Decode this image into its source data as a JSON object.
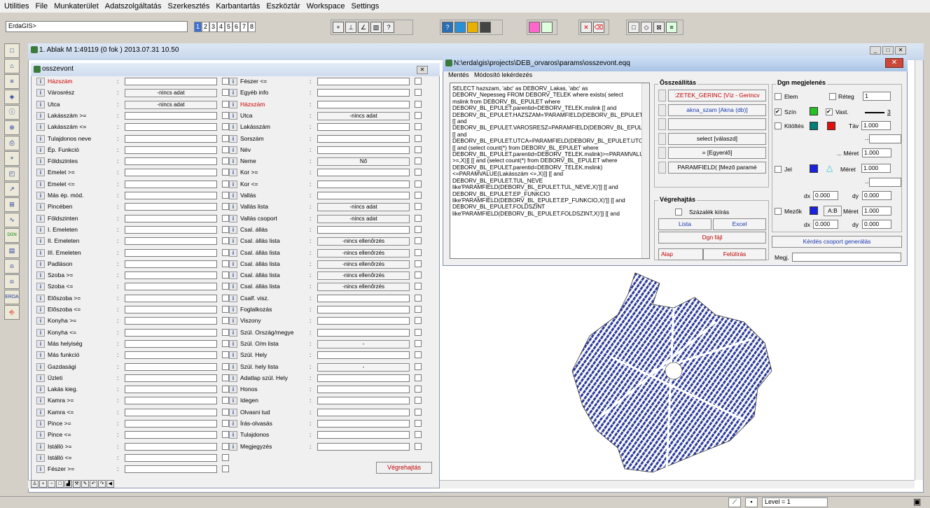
{
  "menubar": [
    "Utilities",
    "File",
    "Munkaterület",
    "Adatszolgáltatás",
    "Szerkesztés",
    "Karbantartás",
    "Eszköztár",
    "Workspace",
    "Settings"
  ],
  "command_value": "ErdaGIS>",
  "view_numbers": [
    "1",
    "2",
    "3",
    "4",
    "5",
    "6",
    "7",
    "8"
  ],
  "window1": {
    "title": "1. Ablak  M 1:49119  (0 fok ) 2013.07.31 10.50"
  },
  "statusbar": {
    "level": "Level = 1"
  },
  "osszevont": {
    "title": "osszevont",
    "info_glyph": "i",
    "colon": ":",
    "left_rows": [
      {
        "label": "Házszám",
        "red": true,
        "type": "field"
      },
      {
        "label": "Városrész",
        "type": "button",
        "value": "-nincs adat"
      },
      {
        "label": "Utca",
        "type": "button",
        "value": "-nincs adat"
      },
      {
        "label": "Lakásszám >=",
        "type": "field"
      },
      {
        "label": "Lakásszám <=",
        "type": "field"
      },
      {
        "label": "Tulajdonos neve",
        "type": "field"
      },
      {
        "label": "Ép. Funkció",
        "type": "field"
      },
      {
        "label": "Földszintes",
        "type": "field"
      },
      {
        "label": "Emelet >=",
        "type": "field"
      },
      {
        "label": "Emelet <=",
        "type": "field"
      },
      {
        "label": "Más ép. mód.",
        "type": "field"
      },
      {
        "label": "Pincében",
        "type": "field"
      },
      {
        "label": "Földszinten",
        "type": "field"
      },
      {
        "label": "I. Emeleten",
        "type": "field"
      },
      {
        "label": "II. Emeleten",
        "type": "field"
      },
      {
        "label": "III. Emeleten",
        "type": "field"
      },
      {
        "label": "Padláson",
        "type": "field"
      },
      {
        "label": "Szoba >=",
        "type": "field"
      },
      {
        "label": "Szoba <=",
        "type": "field"
      },
      {
        "label": "Előszoba >=",
        "type": "field"
      },
      {
        "label": "Előszoba <=",
        "type": "field"
      },
      {
        "label": "Konyha >=",
        "type": "field"
      },
      {
        "label": "Konyha <=",
        "type": "field"
      },
      {
        "label": "Más helyiség",
        "type": "field"
      },
      {
        "label": "Más funkció",
        "type": "field"
      },
      {
        "label": "Gazdasági",
        "type": "field"
      },
      {
        "label": "Üzleti",
        "type": "field"
      },
      {
        "label": "Lakás kieg.",
        "type": "field"
      },
      {
        "label": "Kamra >=",
        "type": "field"
      },
      {
        "label": "Kamra <=",
        "type": "field"
      },
      {
        "label": "Pince >=",
        "type": "field"
      },
      {
        "label": "Pince <=",
        "type": "field"
      },
      {
        "label": "Istálló >=",
        "type": "field"
      },
      {
        "label": "Istálló <=",
        "type": "field"
      },
      {
        "label": "Fészer >=",
        "type": "field"
      }
    ],
    "right_rows": [
      {
        "label": "Fészer <=",
        "type": "field"
      },
      {
        "label": "Egyéb info",
        "type": "field"
      },
      {
        "label": "Házszám",
        "red": true,
        "type": "field"
      },
      {
        "label": "Utca",
        "type": "button",
        "value": "-nincs adat"
      },
      {
        "label": "Lakásszám",
        "type": "field"
      },
      {
        "label": "Sorszám",
        "type": "field"
      },
      {
        "label": "Név",
        "type": "field"
      },
      {
        "label": "Neme",
        "type": "button",
        "value": "Nő"
      },
      {
        "label": "Kor >=",
        "type": "field"
      },
      {
        "label": "Kor <=",
        "type": "field"
      },
      {
        "label": "Vallás",
        "type": "field"
      },
      {
        "label": "Vallás lista",
        "type": "button",
        "value": "-nincs adat"
      },
      {
        "label": "Vallás csoport",
        "type": "button",
        "value": "-nincs adat"
      },
      {
        "label": "Csal. állás",
        "type": "field"
      },
      {
        "label": "Csal. állás lista",
        "type": "button",
        "value": "-nincs ellenőrzés"
      },
      {
        "label": "Csal. állás lista",
        "type": "button",
        "value": "-nincs ellenőrzés"
      },
      {
        "label": "Csal. állás lista",
        "type": "button",
        "value": "-nincs ellenőrzés"
      },
      {
        "label": "Csal. állás lista",
        "type": "button",
        "value": "-nincs ellenőrzés"
      },
      {
        "label": "Csal. állás lista",
        "type": "button",
        "value": "-nincs ellenőrzés"
      },
      {
        "label": "Csalf. visz.",
        "type": "field"
      },
      {
        "label": "Foglalkozás",
        "type": "field"
      },
      {
        "label": "Viszony",
        "type": "field"
      },
      {
        "label": "Szül. Ország/megye",
        "type": "field"
      },
      {
        "label": "Szül. O/m lista",
        "type": "button",
        "value": "-"
      },
      {
        "label": "Szül. Hely",
        "type": "field"
      },
      {
        "label": "Szül. hely lista",
        "type": "button",
        "value": "-"
      },
      {
        "label": "Adatlap szül. Hely",
        "type": "field"
      },
      {
        "label": "Honos",
        "type": "field"
      },
      {
        "label": "Idegen",
        "type": "field"
      },
      {
        "label": "Olvasni tud",
        "type": "field"
      },
      {
        "label": "Írás-olvasás",
        "type": "field"
      },
      {
        "label": "Tulajdonos",
        "type": "field"
      },
      {
        "label": "Megjegyzés",
        "type": "field"
      }
    ],
    "execute_label": "Végrehajtás"
  },
  "eqq": {
    "title": "N:\\erda\\gis\\projects\\DEB_orvaros\\params\\osszevont.eqq",
    "menu": [
      "Mentés",
      "Módosító lekérdezés"
    ],
    "sql": "SELECT hazszam, 'abc' as DEBORV_Lakas, 'abc' as DEBORV_Nepesseg FROM DEBORV_TELEK where exists( select mslink from DEBORV_BL_EPULET where DEBORV_BL_EPULET.parentid=DEBORV_TELEK.mslink [[ and DEBORV_BL_EPULET.HAZSZAM='PARAMFIELD(DEBORV_BL_EPULET.HAZSZAM,X)']] [[ and DEBORV_BL_EPULET.VAROSRESZ=PARAMFIELD(DEBORV_BL_EPULET.VAROSRESZ,X)]] [[ and DEBORV_BL_EPULET.UTCA=PARAMFIELD(DEBORV_BL_EPULET.UTCA,X)]] [[ and (select count(*) from DEBORV_BL_EPULET where DEBORV_BL_EPULET.parentid=DEBORV_TELEK.mslink)>=PARAMVALUE(Lakásszám >=,X)]] [[ and (select count(*) from DEBORV_BL_EPULET where DEBORV_BL_EPULET.parentid=DEBORV_TELEK.mslink)<=PARAMVALUE(Lakásszám <=,X)]] [[ and DEBORV_BL_EPULET.TUL_NEVE like'PARAMFIELD(DEBORV_BL_EPULET.TUL_NEVE,X)']] [[ and DEBORV_BL_EPULET.EP_FUNKCIO like'PARAMFIELD(DEBORV_BL_EPULET.EP_FUNKCIO,X)']] [[ and DEBORV_BL_EPULET.FOLDSZINT like'PARAMFIELD(DEBORV_BL_EPULET.FOLDSZINT,X)']] [[ and",
    "osszeallitas": {
      "title": "Összeállítás",
      "buttons": [
        {
          "label": ":ZETEK_GERINC  [Víz - Gerincv",
          "red": true
        },
        {
          "label": "akna_szam  [Akna (db)]",
          "blue": true
        },
        {
          "label": ""
        },
        {
          "label": "select  [válaszd]"
        },
        {
          "label": "=  [Egyenlő]"
        },
        {
          "label": "PARAMFIELD(  [Mező paramé"
        }
      ]
    },
    "vegrehajtas": {
      "title": "Végrehajtás",
      "szazalek": "Százalék kiírás",
      "lista": "Lista",
      "excel": "Excel",
      "dgn": "Dgn fájl",
      "alap": "Alap",
      "felulir": "Felülírás"
    },
    "dgn": {
      "title": "Dgn megjelenés",
      "elem": "Elem",
      "reteg": "Réteg",
      "reteg_val": "1",
      "szin": "Szín",
      "vast": "Vast.",
      "vast_val": "3",
      "kitoltes": "Kitöltés",
      "tav": "Táv",
      "tav_val": "1.000",
      "ellipsis": "...",
      "meret": "Méret",
      "meret1": "1.000",
      "jel": "Jel",
      "meret2": "1.000",
      "dx": "dx",
      "dx1": "0.000",
      "dy": "dy",
      "dy1": "0.000",
      "mezok": "Mezők",
      "ab": "A:B",
      "meret3": "1.000",
      "dx2": "0.000",
      "dy2": "0.000",
      "kerdes": "Kérdés csoport generálás",
      "megj": "Megj."
    },
    "colors": {
      "green": "#22c322",
      "teal": "#00807a",
      "red": "#e01010",
      "blue": "#1a24e0",
      "cyan": "#22c8d6"
    }
  }
}
